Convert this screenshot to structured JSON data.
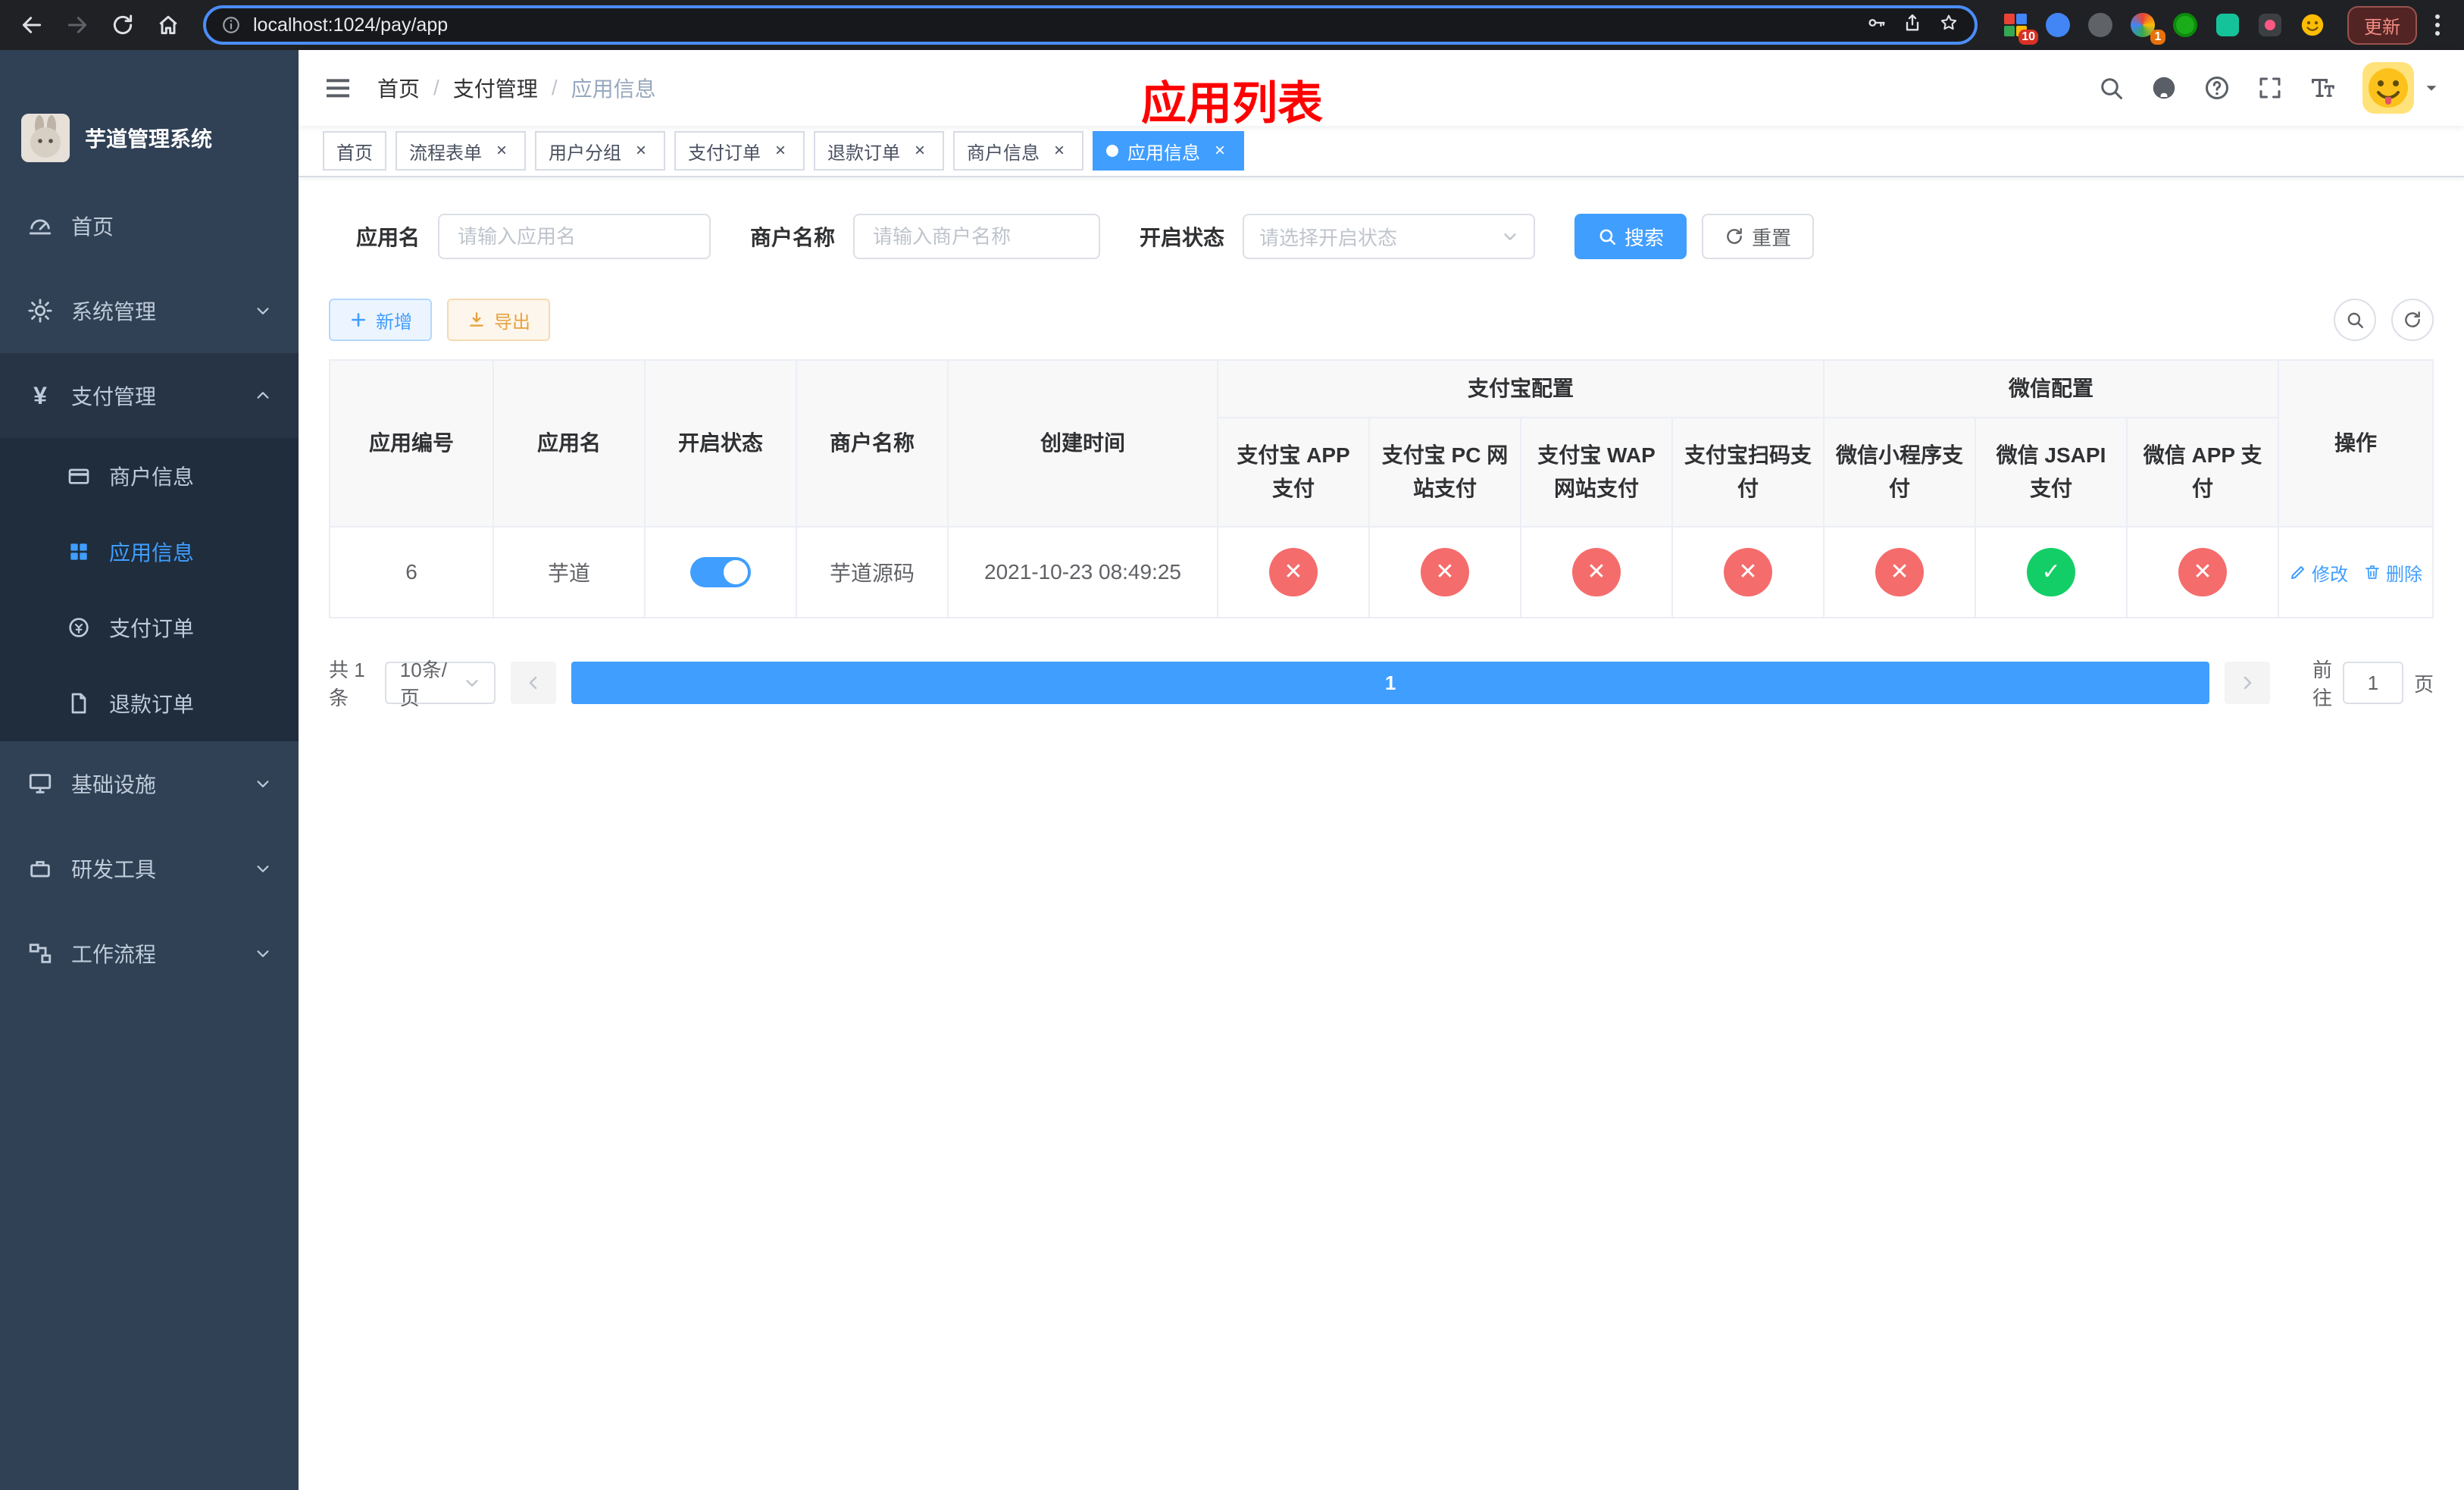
{
  "browser": {
    "url": "localhost:1024/pay/app",
    "update_button": "更新",
    "ext_badge_1": "10",
    "ext_badge_2": "1"
  },
  "icons": {
    "close": "×",
    "yen": "¥"
  },
  "sidebar": {
    "app_title": "芋道管理系统",
    "menu": [
      {
        "label": "首页"
      },
      {
        "label": "系统管理"
      },
      {
        "label": "支付管理"
      },
      {
        "label": "基础设施"
      },
      {
        "label": "研发工具"
      },
      {
        "label": "工作流程"
      }
    ],
    "pay_submenu": [
      {
        "label": "商户信息"
      },
      {
        "label": "应用信息"
      },
      {
        "label": "支付订单"
      },
      {
        "label": "退款订单"
      }
    ]
  },
  "navbar": {
    "breadcrumb": {
      "home": "首页",
      "section": "支付管理",
      "current": "应用信息",
      "separator": "/"
    },
    "overlay_title": "应用列表"
  },
  "tabs": [
    {
      "label": "首页"
    },
    {
      "label": "流程表单"
    },
    {
      "label": "用户分组"
    },
    {
      "label": "支付订单"
    },
    {
      "label": "退款订单"
    },
    {
      "label": "商户信息"
    },
    {
      "label": "应用信息"
    }
  ],
  "filters": {
    "app_name_label": "应用名",
    "app_name_placeholder": "请输入应用名",
    "merchant_label": "商户名称",
    "merchant_placeholder": "请输入商户名称",
    "status_label": "开启状态",
    "status_placeholder": "请选择开启状态",
    "search_button": "搜索",
    "reset_button": "重置"
  },
  "toolbar": {
    "add_button": "新增",
    "export_button": "导出"
  },
  "table": {
    "groups": {
      "alipay": "支付宝配置",
      "wechat": "微信配置"
    },
    "columns": {
      "app_id": "应用编号",
      "app_name": "应用名",
      "status": "开启状态",
      "merchant": "商户名称",
      "create_time": "创建时间",
      "alipay_app": "支付宝 APP 支付",
      "alipay_pc": "支付宝 PC 网站支付",
      "alipay_wap": "支付宝 WAP 网站支付",
      "alipay_qr": "支付宝扫码支付",
      "wx_lite": "微信小程序支付",
      "wx_jsapi": "微信 JSAPI 支付",
      "wx_app": "微信 APP 支付",
      "actions": "操作"
    },
    "glyphs": {
      "enabled": "✓",
      "disabled": "✕"
    },
    "row": {
      "app_id": "6",
      "app_name": "芋道",
      "status_enabled": true,
      "merchant_name": "芋道源码",
      "create_time": "2021-10-23 08:49:25",
      "alipay_app": false,
      "alipay_pc": false,
      "alipay_wap": false,
      "alipay_qr": false,
      "wx_lite": false,
      "wx_jsapi": true,
      "wx_app": false,
      "edit_label": "修改",
      "delete_label": "删除"
    }
  },
  "pagination": {
    "total_text": "共 1 条",
    "page_size_text": "10条/页",
    "page": "1",
    "goto_label": "前往",
    "goto_value": "1",
    "goto_unit": "页"
  }
}
